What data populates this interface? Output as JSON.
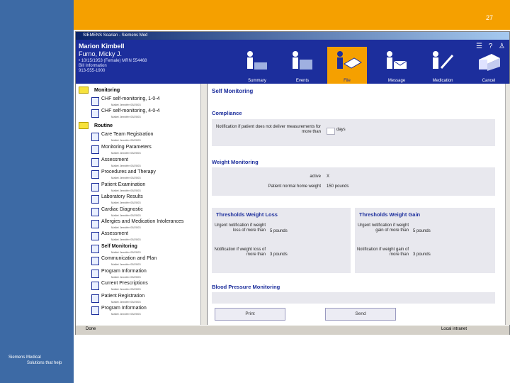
{
  "slide": {
    "number": "27",
    "logo_line1": "Siemens Medical",
    "logo_line2": "Solutions that help"
  },
  "window": {
    "title": "SIEMENS Soarian - Siemens Med"
  },
  "patient": {
    "name": "Marion Kimbell",
    "sub": "Furno, Micky J.",
    "line1": "• 10/15/1953 (Female) MRN 554468",
    "line2": "Bill Information",
    "line3": "913-555-1900"
  },
  "nav": [
    {
      "label": "Summary",
      "icon": "person-icon"
    },
    {
      "label": "Events",
      "icon": "person-icon"
    },
    {
      "label": "File",
      "icon": "person-file-icon"
    },
    {
      "label": "Message",
      "icon": "envelope-icon"
    },
    {
      "label": "Medication",
      "icon": "syringe-icon"
    },
    {
      "label": "Cancel",
      "icon": "printer-icon"
    }
  ],
  "tree": {
    "groups": [
      {
        "label": "Monitoring"
      },
      {
        "label": "Routine"
      }
    ],
    "items": [
      {
        "label": "CHF self-monitoring, 1-0-4",
        "sub": "Mallet Jennifer 05/2003"
      },
      {
        "label": "CHF self-monitoring, 4-0-4",
        "sub": "Mallet Jennifer 05/2003"
      },
      {
        "label": "Care Team Registration",
        "sub": "Mallet Jennifer 05/2003"
      },
      {
        "label": "Monitoring Parameters",
        "sub": "Mallet Jennifer 05/2003"
      },
      {
        "label": "Assessment",
        "sub": "Mallet Jennifer 05/2003"
      },
      {
        "label": "Procedures and Therapy",
        "sub": "Mallet Jennifer 05/2003"
      },
      {
        "label": "Patient Examination",
        "sub": "Mallet Jennifer 05/2003"
      },
      {
        "label": "Laboratory Results",
        "sub": "Mallet Jennifer 05/2003"
      },
      {
        "label": "Cardiac Diagnostic",
        "sub": "Mallet Jennifer 05/2003"
      },
      {
        "label": "Allergies and Medication Intolerances",
        "sub": "Mallet Jennifer 05/2003"
      },
      {
        "label": "Assessment",
        "sub": "Mallet Jennifer 05/2003"
      },
      {
        "label": "Self Monitoring",
        "sub": "Mallet Jennifer 05/2003"
      },
      {
        "label": "Communication and Plan",
        "sub": "Mallet Jennifer 05/2003"
      },
      {
        "label": "Program Information",
        "sub": "Mallet Jennifer 05/2003"
      },
      {
        "label": "Current Prescriptions",
        "sub": "Mallet Jennifer 05/2003"
      },
      {
        "label": "Patient Registration",
        "sub": "Mallet Jennifer 05/2003"
      },
      {
        "label": "Program Information",
        "sub": "Mallet Jennifer 05/2003"
      }
    ]
  },
  "main": {
    "title": "Self Monitoring",
    "compliance": {
      "heading": "Compliance",
      "label": "Notification if patient does not deliver measurements for more than",
      "unit": "days"
    },
    "weight": {
      "heading": "Weight Monitoring",
      "active_label": "active",
      "active_value": "X",
      "normal_label": "Patient normal home weight",
      "normal_value": "150 pounds"
    },
    "loss": {
      "heading": "Thresholds Weight Loss",
      "urgent_label": "Urgent notification if weight loss of more than",
      "urgent_value": "5 pounds",
      "notify_label": "Notification if weight loss of more than",
      "notify_value": "3 pounds"
    },
    "gain": {
      "heading": "Thresholds Weight Gain",
      "urgent_label": "Urgent notification if weight gain of more than",
      "urgent_value": "5 pounds",
      "notify_label": "Notification if weight gain of more than",
      "notify_value": "3 pounds"
    },
    "bp_heading": "Blood Pressure Monitoring",
    "print_label": "Print",
    "send_label": "Send"
  },
  "status": {
    "left": "Done",
    "right": "Local intranet"
  }
}
